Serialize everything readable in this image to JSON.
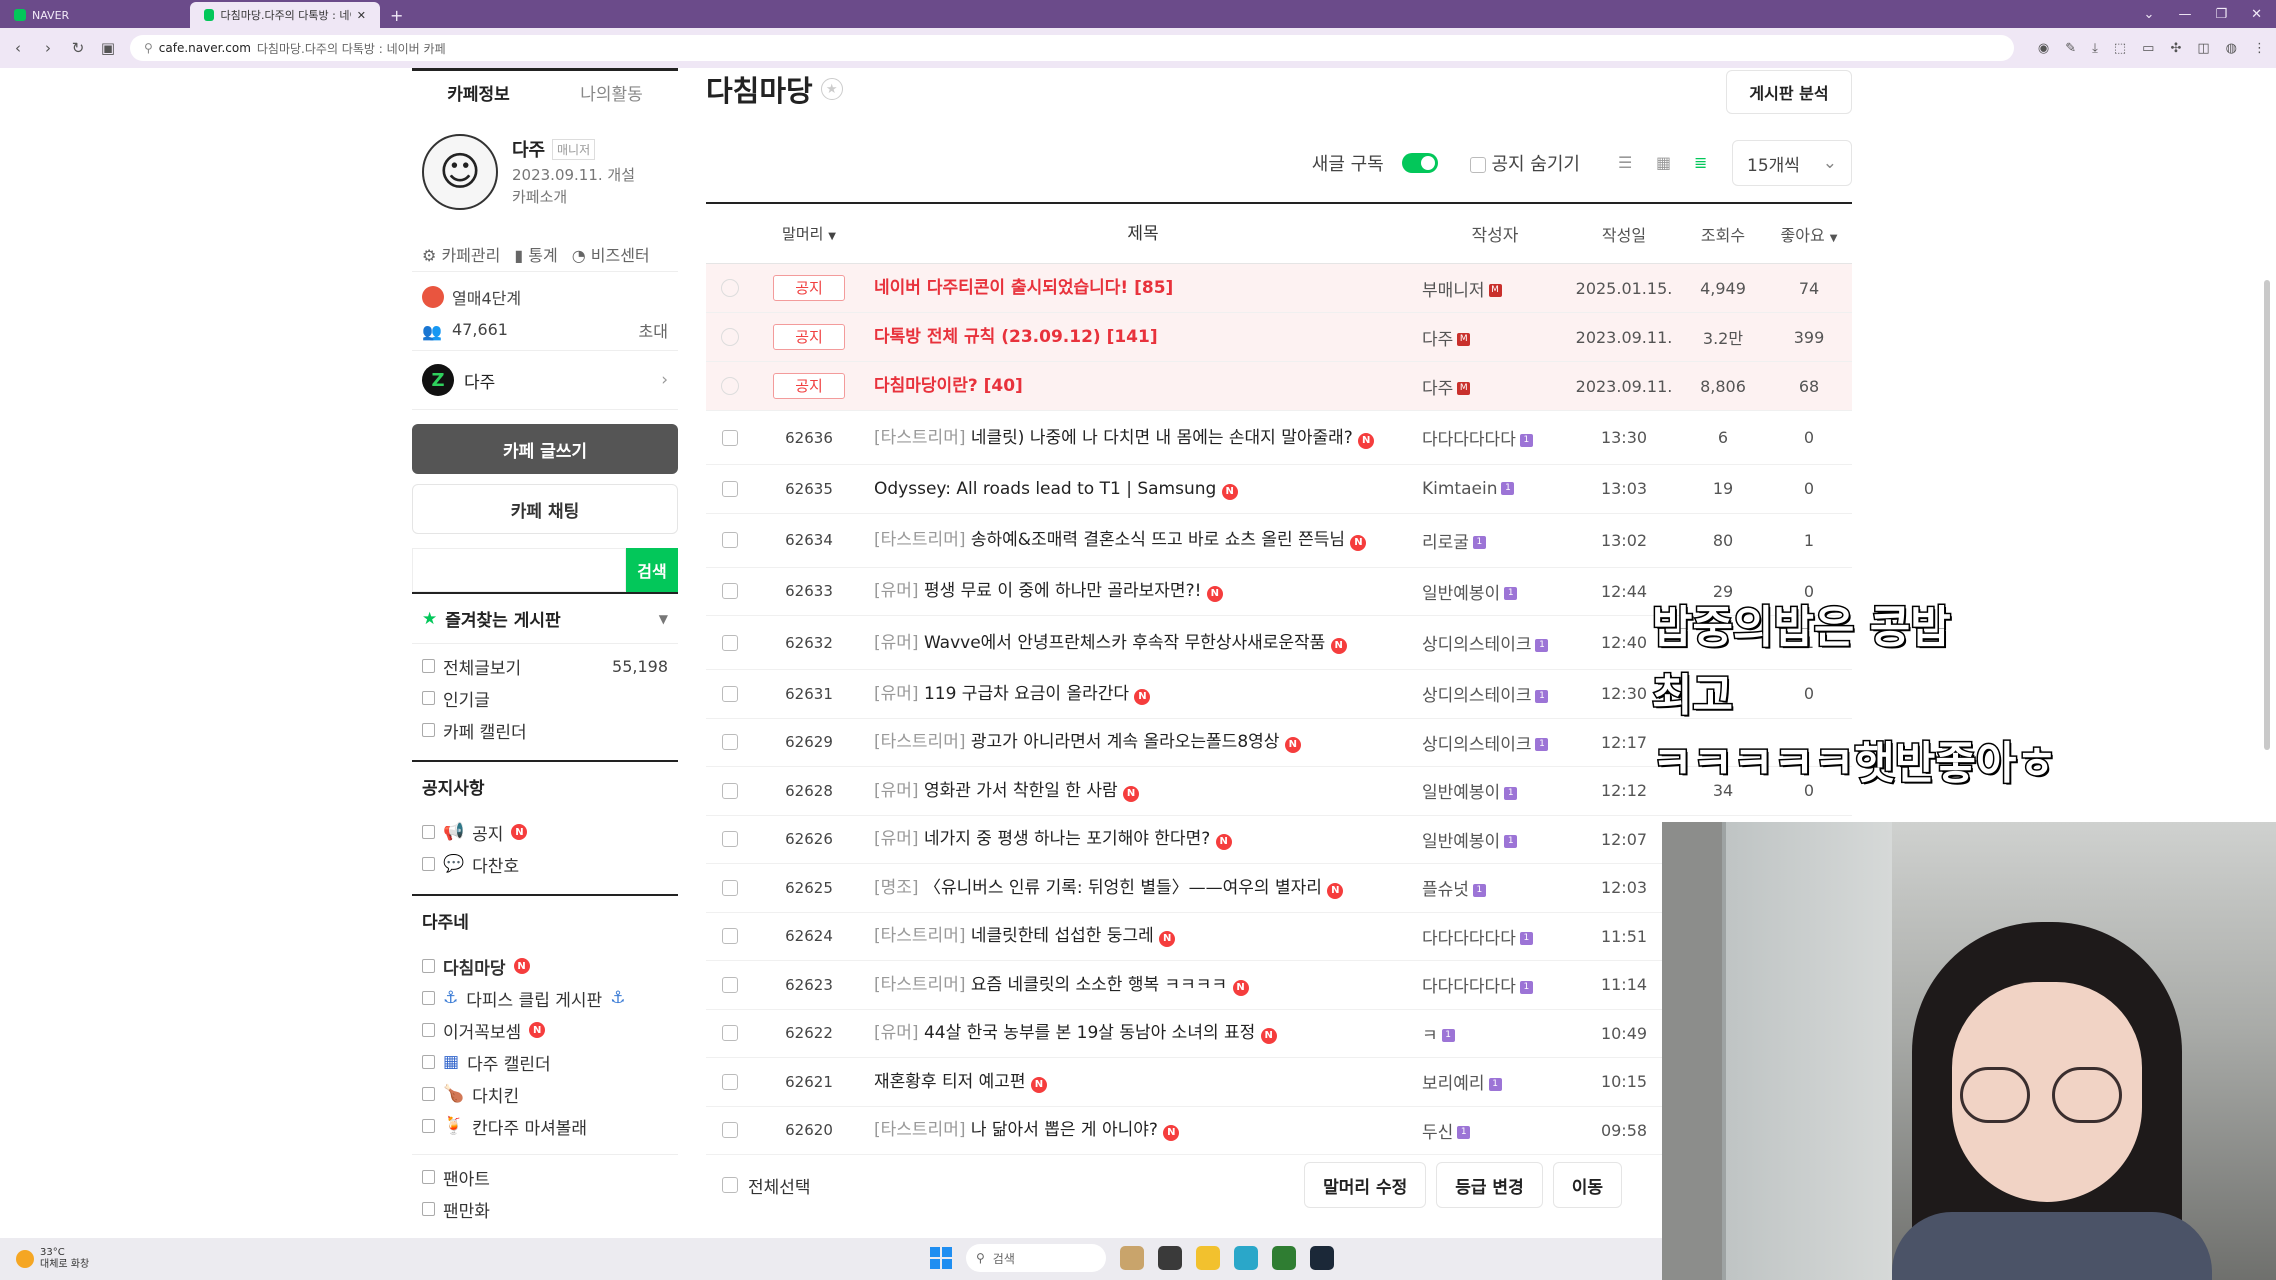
{
  "browser": {
    "tabs": [
      {
        "label": "NAVER"
      },
      {
        "label": "다침마당.다주의 다톡방 : 네이버"
      }
    ],
    "url_domain": "cafe.naver.com",
    "url_rest": "다침마당.다주의 다톡방 : 네이버 카페"
  },
  "sidebar": {
    "tabs": [
      "카페정보",
      "나의활동"
    ],
    "profile": {
      "name": "다주",
      "role": "매니저",
      "date": "2023.09.11. 개설",
      "intro": "카페소개"
    },
    "links": [
      "카페관리",
      "통계",
      "비즈센터"
    ],
    "level": "열매4단계",
    "members": "47,661",
    "invite": "초대",
    "owner": "다주",
    "write_btn": "카페 글쓰기",
    "chat_btn": "카페 채팅",
    "search_btn": "검색",
    "favorites_title": "즐겨찾는 게시판",
    "fav_items": [
      {
        "label": "전체글보기",
        "count": "55,198"
      },
      {
        "label": "인기글",
        "count": ""
      },
      {
        "label": "카페 캘린더",
        "count": ""
      }
    ],
    "notice_section": "공지사항",
    "notice_items": [
      "공지",
      "다찬호"
    ],
    "dajune_section": "다주네",
    "dajune_items": [
      "다침마당",
      "다피스 클립 게시판",
      "이거꼭보셈",
      "다주 캘린더",
      "다치킨",
      "칸다주 마셔볼래"
    ],
    "extra_items": [
      "팬아트",
      "팬만화"
    ]
  },
  "main": {
    "title": "다침마당",
    "analysis_btn": "게시판 분석",
    "subscribe_label": "새글 구독",
    "hide_notice_label": "공지 숨기기",
    "per_page": "15개씩",
    "headers": {
      "head": "말머리",
      "title": "제목",
      "writer": "작성자",
      "date": "작성일",
      "views": "조회수",
      "likes": "좋아요"
    },
    "notice_tag": "공지",
    "notices": [
      {
        "title": "네이버 다주티콘이 출시되었습니다! [85]",
        "writer": "부매니저",
        "date": "2025.01.15.",
        "views": "4,949",
        "likes": "74"
      },
      {
        "title": "다톡방 전체 규칙 (23.09.12) [141]",
        "writer": "다주",
        "date": "2023.09.11.",
        "views": "3.2만",
        "likes": "399"
      },
      {
        "title": "다침마당이란? [40]",
        "writer": "다주",
        "date": "2023.09.11.",
        "views": "8,806",
        "likes": "68"
      }
    ],
    "posts": [
      {
        "num": "62636",
        "head": "[타스트리머]",
        "title": "네클릿) 나중에 나 다치면 내 몸에는 손대지 말아줄래?",
        "writer": "다다다다다다",
        "date": "13:30",
        "views": "6",
        "likes": "0"
      },
      {
        "num": "62635",
        "head": "",
        "title": "Odyssey: All roads lead to T1 | Samsung",
        "writer": "Kimtaein",
        "date": "13:03",
        "views": "19",
        "likes": "0"
      },
      {
        "num": "62634",
        "head": "[타스트리머]",
        "title": "송하예&조매력 결혼소식 뜨고 바로 쇼츠 올린 쯘득님",
        "writer": "리로굴",
        "date": "13:02",
        "views": "80",
        "likes": "1"
      },
      {
        "num": "62633",
        "head": "[유머]",
        "title": "평생 무료 이 중에 하나만 골라보자면?!",
        "writer": "일반예봉이",
        "date": "12:44",
        "views": "29",
        "likes": "0"
      },
      {
        "num": "62632",
        "head": "[유머]",
        "title": "Wavve에서 안녕프란체스카 후속작 무한상사새로운작품",
        "writer": "상디의스테이크",
        "date": "12:40",
        "views": "",
        "likes": "1"
      },
      {
        "num": "62631",
        "head": "[유머]",
        "title": "119 구급차 요금이 올라간다",
        "writer": "상디의스테이크",
        "date": "12:30",
        "views": "",
        "likes": "0"
      },
      {
        "num": "62629",
        "head": "[타스트리머]",
        "title": "광고가 아니라면서 계속 올라오는폴드8영상",
        "writer": "상디의스테이크",
        "date": "12:17",
        "views": "",
        "likes": ""
      },
      {
        "num": "62628",
        "head": "[유머]",
        "title": "영화관 가서 착한일 한 사람",
        "writer": "일반예봉이",
        "date": "12:12",
        "views": "34",
        "likes": "0"
      },
      {
        "num": "62626",
        "head": "[유머]",
        "title": "네가지 중 평생 하나는 포기해야 한다면?",
        "writer": "일반예봉이",
        "date": "12:07",
        "views": "",
        "likes": ""
      },
      {
        "num": "62625",
        "head": "[명조]",
        "title": "〈유니버스 인류 기록: 뒤엉힌 별들〉——여우의 별자리",
        "writer": "플슈넛",
        "date": "12:03",
        "views": "",
        "likes": ""
      },
      {
        "num": "62624",
        "head": "[타스트리머]",
        "title": "네클릿한테 섭섭한 둥그레",
        "writer": "다다다다다다",
        "date": "11:51",
        "views": "",
        "likes": ""
      },
      {
        "num": "62623",
        "head": "[타스트리머]",
        "title": "요즘 네클릿의 소소한 행복 ㅋㅋㅋㅋ",
        "writer": "다다다다다다",
        "date": "11:14",
        "views": "",
        "likes": ""
      },
      {
        "num": "62622",
        "head": "[유머]",
        "title": "44살 한국 농부를 본 19살 동남아 소녀의 표정",
        "writer": "ㅋ",
        "date": "10:49",
        "views": "",
        "likes": ""
      },
      {
        "num": "62621",
        "head": "",
        "title": "재혼황후 티저 예고편",
        "writer": "보리예리",
        "date": "10:15",
        "views": "",
        "likes": ""
      },
      {
        "num": "62620",
        "head": "[타스트리머]",
        "title": "나 닮아서 뽑은 게 아니야?",
        "writer": "두신",
        "date": "09:58",
        "views": "",
        "likes": ""
      }
    ],
    "select_all": "전체선택",
    "bottom_buttons": [
      "말머리 수정",
      "등급 변경",
      "이동"
    ]
  },
  "subtitles": [
    "밥중의밥은 콩밥",
    "최고",
    "ㅋㅋㅋㅋㅋ햇반좋아ㅎ"
  ],
  "taskbar": {
    "temp": "33°C",
    "weather": "대체로 화창",
    "search": "검색"
  },
  "colors": {
    "accent": "#03c75a",
    "notice_red": "#e8323c",
    "tab_bar": "#6b4b8a"
  }
}
